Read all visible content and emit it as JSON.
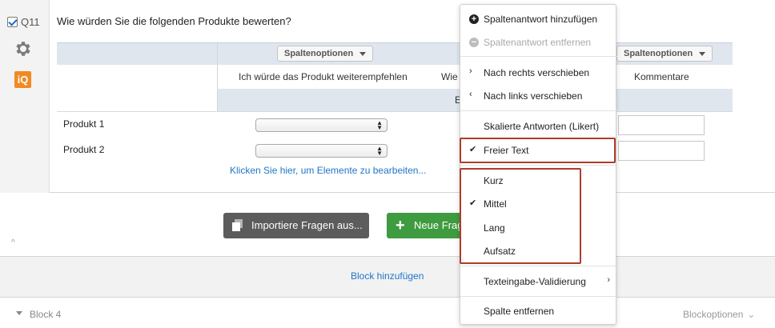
{
  "question": {
    "id": "Q11",
    "title": "Wie würden Sie die folgenden Produkte bewerten?",
    "edit_link": "Klicken Sie hier, um Elemente zu bearbeiten...",
    "iq_badge": "iQ"
  },
  "matrix": {
    "columns": [
      {
        "options_label": "Spaltenoptionen",
        "label": "Ich würde das Produkt weiterempfehlen"
      },
      {
        "options_label": "",
        "label": "Wie",
        "sub": "E"
      },
      {
        "options_label": "Spaltenoptionen",
        "label": "Kommentare"
      }
    ],
    "rows": [
      {
        "label": "Produkt 1"
      },
      {
        "label": "Produkt 2"
      }
    ]
  },
  "actions": {
    "import": "Importiere Fragen aus...",
    "new_question": "Neue Frage",
    "add_block": "Block hinzufügen"
  },
  "block4": {
    "label": "Block 4",
    "options": "Blockoptionen"
  },
  "menu": {
    "add_answer": "Spaltenantwort hinzufügen",
    "remove_answer": "Spaltenantwort entfernen",
    "move_right": "Nach rechts verschieben",
    "move_left": "Nach links verschieben",
    "scaled": "Skalierte Antworten (Likert)",
    "free_text": "Freier Text",
    "short": "Kurz",
    "medium": "Mittel",
    "long": "Lang",
    "essay": "Aufsatz",
    "validation": "Texteingabe-Validierung",
    "remove_column": "Spalte entfernen"
  },
  "colors": {
    "accent_blue": "#1f76c7",
    "highlight_red": "#b13b2a",
    "new_button_green": "#3f9b3f",
    "import_button_gray": "#5c5c5c",
    "iq_orange": "#f08a24",
    "header_band": "#dfe6ee"
  }
}
